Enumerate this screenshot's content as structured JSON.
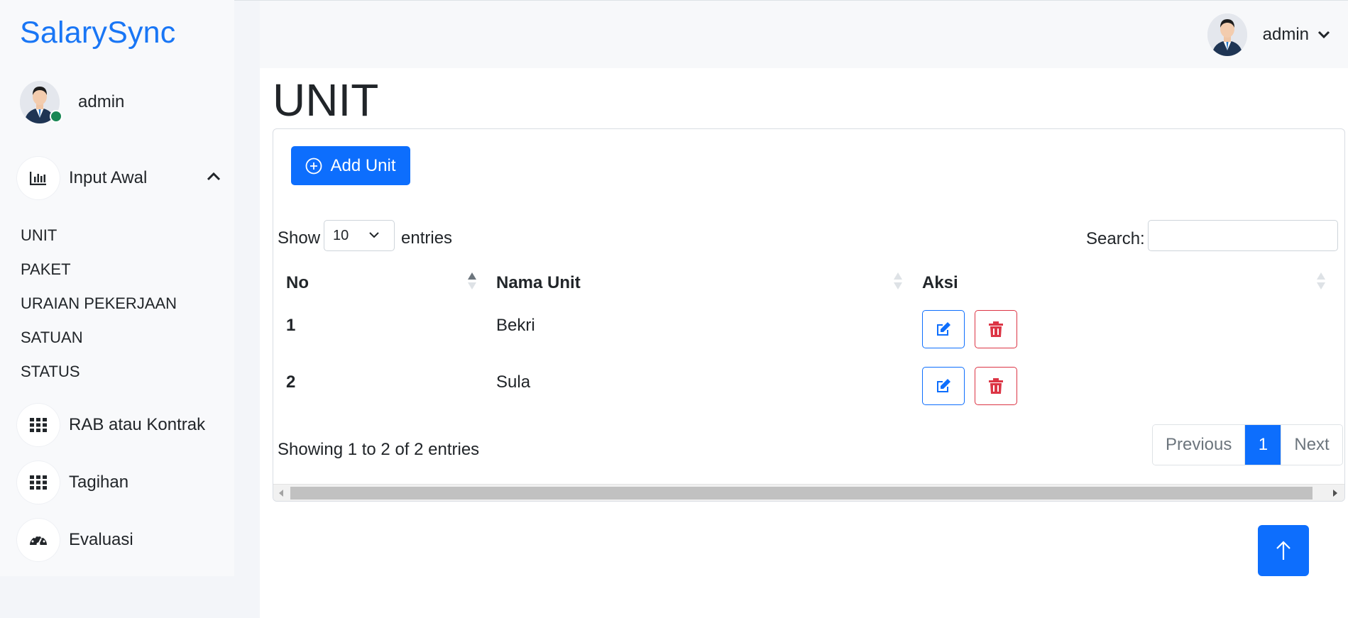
{
  "app": {
    "brand": "SalarySync"
  },
  "sidebar": {
    "username": "admin",
    "menu": [
      {
        "label": "Input Awal",
        "icon": "bar-chart-icon",
        "expanded": true
      },
      {
        "label": "RAB atau Kontrak",
        "icon": "grid-icon"
      },
      {
        "label": "Tagihan",
        "icon": "grid-icon"
      },
      {
        "label": "Evaluasi",
        "icon": "speedometer-icon"
      }
    ],
    "submenu": [
      "UNIT",
      "PAKET",
      "URAIAN PEKERJAAN",
      "SATUAN",
      "STATUS"
    ]
  },
  "topbar": {
    "username": "admin"
  },
  "page": {
    "title": "UNIT"
  },
  "toolbar": {
    "add_label": "Add Unit"
  },
  "table_controls": {
    "show_label": "Show",
    "page_length": "10",
    "entries_label": "entries",
    "search_label": "Search:",
    "search_value": ""
  },
  "table": {
    "columns": [
      "No",
      "Nama Unit",
      "Aksi"
    ],
    "rows": [
      {
        "no": "1",
        "nama_unit": "Bekri"
      },
      {
        "no": "2",
        "nama_unit": "Sula"
      }
    ]
  },
  "footer": {
    "info": "Showing 1 to 2 of 2 entries",
    "prev_label": "Previous",
    "page": "1",
    "next_label": "Next"
  },
  "colors": {
    "primary": "#0d6efd",
    "danger": "#dc3545",
    "brand": "#1976f5",
    "online": "#198754"
  }
}
